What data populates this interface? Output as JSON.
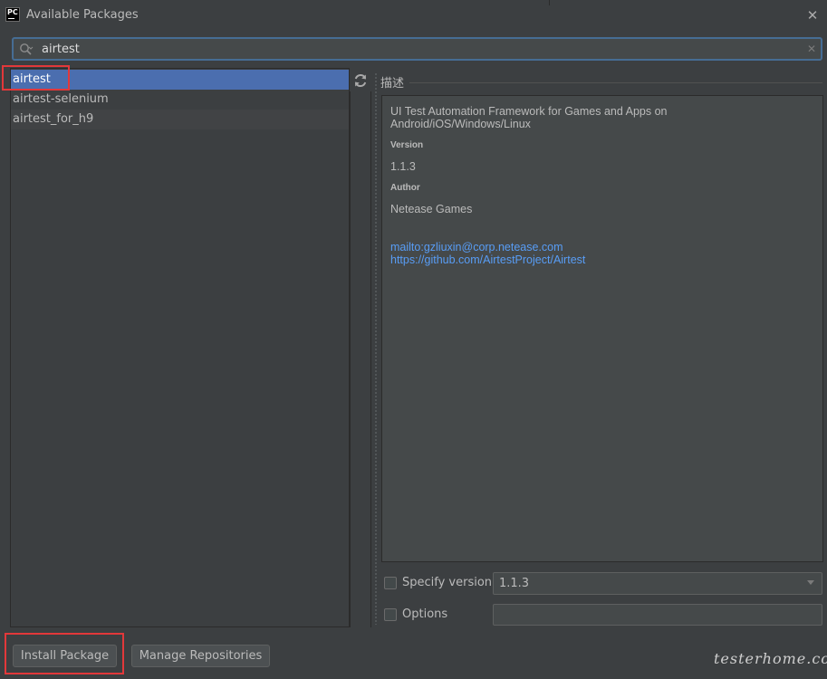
{
  "window": {
    "title": "Available Packages",
    "app_icon_text": "PC"
  },
  "search": {
    "value": "airtest",
    "clear_glyph": "✕"
  },
  "packages": [
    {
      "name": "airtest",
      "selected": true
    },
    {
      "name": "airtest-selenium",
      "selected": false
    },
    {
      "name": "airtest_for_h9",
      "selected": false
    }
  ],
  "description": {
    "header": "描述",
    "summary": "UI Test Automation Framework for Games and Apps on Android/iOS/Windows/Linux",
    "version_label": "Version",
    "version_value": "1.1.3",
    "author_label": "Author",
    "author_value": "Netease Games",
    "links": [
      "mailto:gzliuxin@corp.netease.com",
      "https://github.com/AirtestProject/Airtest"
    ]
  },
  "options": {
    "specify_version_label": "Specify version",
    "specify_version_checked": false,
    "version_select_value": "1.1.3",
    "options_label": "Options",
    "options_checked": false,
    "options_value": ""
  },
  "buttons": {
    "install": "Install Package",
    "manage": "Manage Repositories"
  },
  "watermark": "testerhome.com",
  "colors": {
    "background": "#3c3f41",
    "selection": "#4b6eaf",
    "link": "#589df6",
    "highlight": "#e2383a"
  },
  "icons": [
    "app-icon",
    "search-icon",
    "close-icon",
    "clear-icon",
    "refresh-icon",
    "chevron-down-icon"
  ]
}
